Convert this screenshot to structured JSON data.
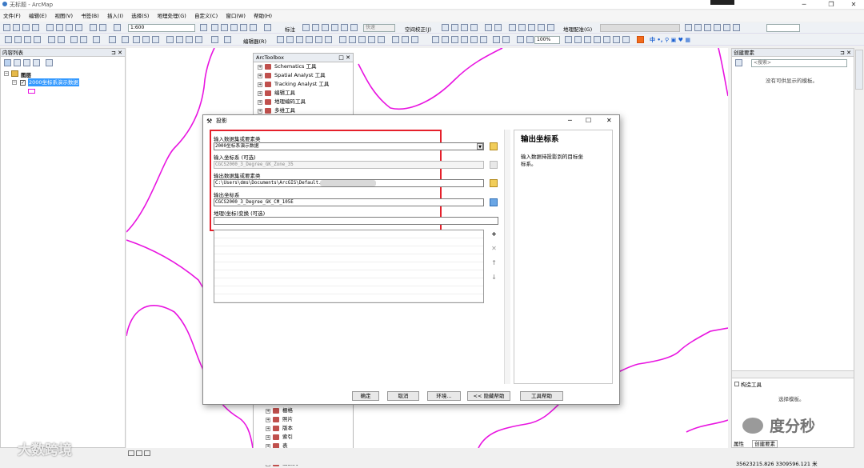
{
  "app": {
    "title": "无标题 - ArcMap"
  },
  "menu": [
    "文件(F)",
    "编辑(E)",
    "视图(V)",
    "书签(B)",
    "插入(I)",
    "选择(S)",
    "地理处理(G)",
    "自定义(C)",
    "窗口(W)",
    "帮助(H)"
  ],
  "toolbar": {
    "scale": "1:600",
    "label_tool": "标注",
    "fast": "快速",
    "spatial_adjust": "空间校正(J)",
    "georeference": "地理配准(G)",
    "editor": "编辑器(R)",
    "zoom": "100%"
  },
  "toc": {
    "title": "内容列表",
    "layers_group": "图层",
    "layer": "2000坐标系演示数据"
  },
  "arctoolbox": {
    "title": "ArcToolbox",
    "top_items": [
      "Schematics 工具",
      "Spatial Analyst 工具",
      "Tracking Analyst 工具",
      "编辑工具",
      "地理编码工具",
      "多维工具"
    ],
    "bottom_items": [
      "栅格",
      "照片",
      "版本",
      "索引",
      "表",
      "要素",
      "要素类"
    ]
  },
  "right_panel": {
    "title": "创建要素",
    "search_placeholder": "<搜索>",
    "empty_msg": "没有可供显示的模板。",
    "construct_title": "构造工具",
    "construct_msg": "选择模板。",
    "tab_props": "属性",
    "tab_create": "创建要素"
  },
  "dialog": {
    "title": "投影",
    "fields": {
      "input_label": "输入数据集或要素类",
      "input_value": "2000坐标系演示数据",
      "incs_label": "输入坐标系 (可选)",
      "incs_value": "CGCS2000_3_Degree_GK_Zone_35",
      "output_label": "输出数据集或要素类",
      "output_value": "C:\\Users\\dms\\Documents\\ArcGIS\\Default.",
      "outcs_label": "输出坐标系",
      "outcs_value": "CGCS2000_3_Degree_GK_CM_105E",
      "transform_label": "地理(坐标)变换 (可选)"
    },
    "help": {
      "title": "输出坐标系",
      "text": "输入数据待投影到的目标坐标系。"
    },
    "buttons": {
      "ok": "确定",
      "cancel": "取消",
      "env": "环境...",
      "hide_help": "<< 隐藏帮助",
      "tool_help": "工具帮助"
    }
  },
  "status": {
    "coords": "35623215.826  3309596.121 米"
  },
  "watermark": {
    "left": "大数跨境",
    "right": "度分秒"
  },
  "colors": {
    "highlight": "#e5202b",
    "feature_line": "#e814e0",
    "selection": "#3399ff"
  }
}
